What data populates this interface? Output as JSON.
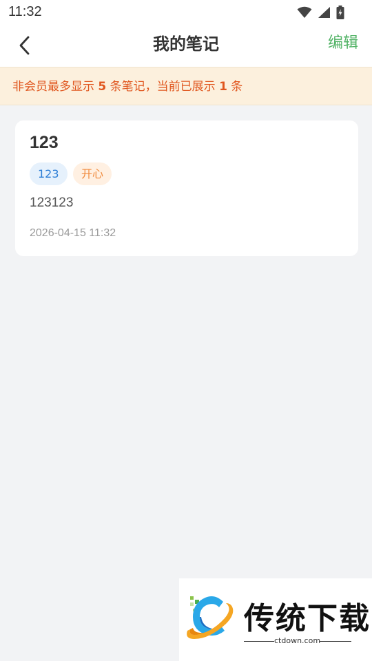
{
  "status_bar": {
    "time": "11:32"
  },
  "nav": {
    "title": "我的笔记",
    "edit_label": "编辑",
    "back_icon": "chevron-left-icon"
  },
  "notice": {
    "prefix": "非会员最多显示 ",
    "max_count": "5",
    "middle": " 条笔记，当前已展示 ",
    "shown_count": "1",
    "suffix": " 条"
  },
  "notes": [
    {
      "title": "123",
      "tags": [
        "123",
        "开心"
      ],
      "content": "123123",
      "date": "2026-04-15 11:32"
    }
  ],
  "watermark": {
    "name": "传统下载",
    "site": "ctdown.com"
  },
  "colors": {
    "accent_green": "#52b366",
    "notice_text": "#e0561e",
    "notice_bg": "#fcf0dd",
    "tag_blue_bg": "#e6f1fc",
    "tag_blue_text": "#2f7fd6",
    "tag_orange_bg": "#fff0e2",
    "tag_orange_text": "#f08a3c",
    "page_bg": "#f2f3f5"
  }
}
